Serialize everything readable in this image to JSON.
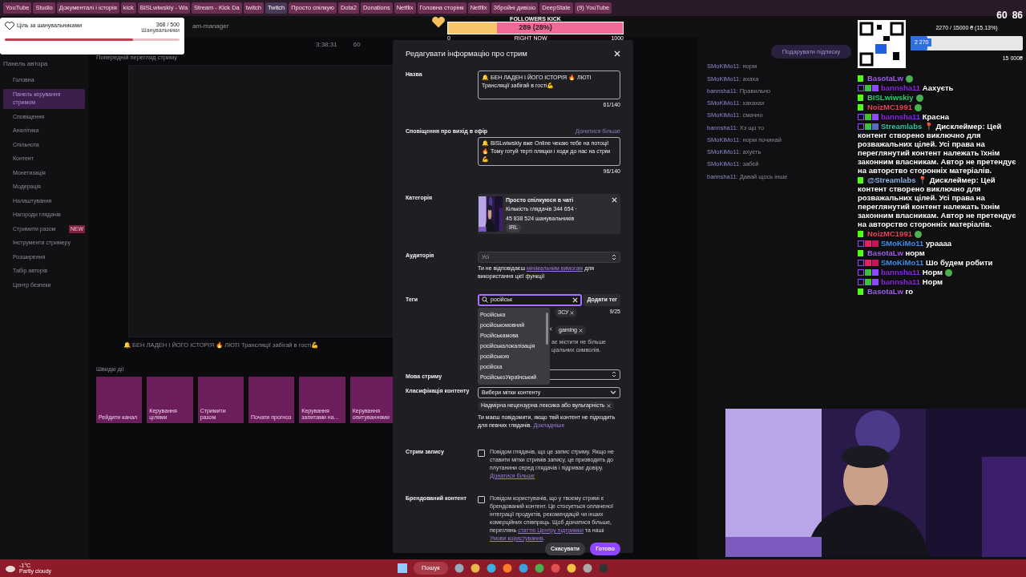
{
  "browser_tabs": [
    {
      "label": "YouTube",
      "selected": false
    },
    {
      "label": "Studio",
      "selected": false
    },
    {
      "label": "Документалі і історія",
      "selected": false
    },
    {
      "label": "kick",
      "selected": false
    },
    {
      "label": "BISLwiwskiy - Wa",
      "selected": false
    },
    {
      "label": "Stream - Kick Da",
      "selected": false
    },
    {
      "label": "twitch",
      "selected": false
    },
    {
      "label": "Twitch",
      "selected": true
    },
    {
      "label": "Просто спілкую",
      "selected": false
    },
    {
      "label": "Dota2",
      "selected": false
    },
    {
      "label": "Donations",
      "selected": false
    },
    {
      "label": "Netflix",
      "selected": false
    },
    {
      "label": "Головна сторінк",
      "selected": false
    },
    {
      "label": "Netflix",
      "selected": false
    },
    {
      "label": "Збройні дивізіо",
      "selected": false
    },
    {
      "label": "DeepState",
      "selected": false
    },
    {
      "label": "(9) YouTube",
      "selected": false
    }
  ],
  "address": "am-manager",
  "goal_widget": {
    "title": "Ціль за шанувальниками",
    "count": "368 / 500",
    "unit": "Шанувальники",
    "level": 0.736
  },
  "followers_bar": {
    "title": "FOLLOWERS KICK",
    "reading": "289 (28%)",
    "level": 0.28,
    "min": "0",
    "mid": "RIGHT NOW",
    "max": "1000"
  },
  "counters": [
    "60",
    "86"
  ],
  "donation_goal": {
    "reading": "2270 / 15000 ₴ (15.13%)",
    "badge": "2 270",
    "max": "15 000₴",
    "level": 0.1513
  },
  "sidebar": {
    "title": "Панель автора",
    "items": [
      {
        "label": "Головна",
        "selected": false
      },
      {
        "label": "Панель керування стримом",
        "selected": true
      },
      {
        "label": "Сповіщення",
        "selected": false
      },
      {
        "label": "Аналітика",
        "selected": false
      },
      {
        "label": "Спільнота",
        "selected": false
      },
      {
        "label": "Контент",
        "selected": false
      },
      {
        "label": "Монетизація",
        "selected": false
      },
      {
        "label": "Модерація",
        "selected": false
      },
      {
        "label": "Налаштування",
        "selected": false
      },
      {
        "label": "Нагороди глядачів",
        "selected": false
      },
      {
        "label": "Стримити разом",
        "selected": false,
        "badge": "NEW"
      },
      {
        "label": "Інструменти стримеру",
        "selected": false
      },
      {
        "label": "Розширення",
        "selected": false
      },
      {
        "label": "Табір авторів",
        "selected": false
      },
      {
        "label": "Центр безпеки",
        "selected": false
      }
    ]
  },
  "stats": [
    "3:38:31",
    "60"
  ],
  "preview": {
    "title": "Попередній перегляд стриму",
    "stream_title": "🔔 БЕН ЛАДЕН І ЙОГО ІСТОРІЯ 🔥 ЛЮТІ Трансляції забігай в гості💪"
  },
  "quick_actions": {
    "title": "Швидкі дії",
    "tiles": [
      {
        "label": "Рейдити канал",
        "color": "#6b1d5c"
      },
      {
        "label": "Керування цілями",
        "color": "#6b1d5c"
      },
      {
        "label": "Стримити разом",
        "color": "#6b1d5c"
      },
      {
        "label": "Почати прогноз",
        "color": "#6b1d5c"
      },
      {
        "label": "Керування запитами на...",
        "color": "#6b1d5c"
      },
      {
        "label": "Керування опитуваннями",
        "color": "#6b1d5c"
      }
    ]
  },
  "modal": {
    "title": "Редагувати інформацію про стрим",
    "name": {
      "label": "Назва",
      "value": "🔔 БЕН ЛАДЕН І ЙОГО ІСТОРІЯ 🔥 ЛЮТІ Трансляції забігай в гості💪",
      "count": "61/140"
    },
    "notification": {
      "label": "Сповіщення про вихід в ефір",
      "link": "Дізнатися більше",
      "value": "🔔 BISLwiwskiy вже Online чекаю тебе на потоці! 🔥 Тому готуй терті пляцки і ходи до нас на стрім 💪",
      "count": "96/140"
    },
    "category": {
      "label": "Категорія",
      "name": "Просто спілкуюся в чаті",
      "viewers": "Кількість глядачів 344 654 ·",
      "followers": "45 838 524 шанувальників",
      "tag": "IRL"
    },
    "audience": {
      "label": "Аудиторія",
      "value": "Усі",
      "note_before": "Ти не відповідаєш",
      "note_link": "мінімальним вимогам",
      "note_after": "для використання цієї функції"
    },
    "tags": {
      "label": "Теги",
      "query": "російськ",
      "add_button": "Додати тег",
      "count": "9/25",
      "visible_tags": [
        "ЗСУ",
        "gaming"
      ],
      "hint_fragments": [
        "ає містити не більше",
        "ціальних символів."
      ],
      "suggestions": [
        "Російська",
        "російськомовний",
        "Російськамова",
        "російськалокалізація",
        "російською",
        "російска",
        "РосійськоУкраїнський"
      ]
    },
    "language": {
      "label": "Мова стриму"
    },
    "classification": {
      "label": "Класифікація контенту",
      "placeholder": "Вибери мітки контенту",
      "chip": "Надмірна нецензурна лексика або вульгарність",
      "note": "Ти маєш повідомити, якщо твій контент не підходить для певних глядачів.",
      "note_link": "Докладніше"
    },
    "rerun": {
      "label": "Стрим запису",
      "checked": false,
      "text": "Повідом глядачів, що це запис стриму. Якщо не ставити мітки стримів запису, це призводить до плутанини серед глядачів і підриває довіру.",
      "link": "Дізнатися більше"
    },
    "branded": {
      "label": "Брендований контент",
      "checked": false,
      "text": "Повідом користувачів, що у твоєму стримі є брендований контент. Це стосується оплаченої інтеграції продуктів, рекомендацій чи інших комерційних співпраць. Щоб дізнатися більше, переглянь",
      "link1": "статтю Центру підтримки",
      "middle": "та наші",
      "link2": "Умови користування",
      "end": "."
    },
    "cancel": "Скасувати",
    "done": "Готово"
  },
  "bg_chat": {
    "gift_button": "Подарувати підписку",
    "lines": [
      {
        "user": "SMoKiMo11",
        "text": ": норм"
      },
      {
        "user": "SMoKiMo11",
        "text": ": ахаха"
      },
      {
        "user": "bannsha11",
        "text": ": Правильно"
      },
      {
        "user": "SMoKiMo11",
        "text": ": хахахах"
      },
      {
        "user": "SMoKiMo11",
        "text": ": смачно"
      },
      {
        "user": "bannsha11",
        "text": ": Хз що то"
      },
      {
        "user": "SMoKiMo11",
        "text": ": норм починай"
      },
      {
        "user": "SMoKiMo11",
        "text": ": ахуєть"
      },
      {
        "user": "SMoKiMo11",
        "text": ": забєй"
      },
      {
        "user": "bannsha11",
        "text": ": Давай щось інше"
      }
    ]
  },
  "chat": [
    {
      "kind": "kick",
      "user": "BasotaLw",
      "color": "#a45ef0",
      "emote": true
    },
    {
      "kind": "twitch",
      "badges": [
        {
          "color": "#3fbf3f"
        },
        {
          "color": "#9146ff"
        }
      ],
      "user": "bannsha11",
      "color": "#8a2be2",
      "text": "Аахуєть",
      "emote": false
    },
    {
      "kind": "kick",
      "user": "BISLwiwskiy",
      "color": "#2ecc71",
      "emote": true
    },
    {
      "kind": "kick",
      "user": "NoizMC1991",
      "color": "#e8475b",
      "emote": true
    },
    {
      "kind": "twitch",
      "badges": [
        {
          "color": "#3fbf3f"
        },
        {
          "color": "#9146ff"
        }
      ],
      "user": "bannsha11",
      "color": "#8a2be2",
      "text": "Красна",
      "emote": false
    },
    {
      "kind": "twitch",
      "badges": [
        {
          "color": "#3fbf3f"
        },
        {
          "color": "#5c6bc0"
        }
      ],
      "user": "Streamlabs",
      "color": "#31c3a2",
      "text": "📍 Дисклеймер: Цей контент створено виключно для розважальних цілей. Усі права на переглянутий контент належать їхнім законним власникам. Автор не претендує на авторство сторонніх матеріалів.",
      "emote": false
    },
    {
      "kind": "kick",
      "user": "@Streamlabs",
      "color": "#8fb4e8",
      "text": "📍 Дисклеймер: Цей контент створено виключно для розважальних цілей. Усі права на переглянутий контент належать їхнім законним власникам. Автор не претендує на авторство сторонніх матеріалів.",
      "emote": false
    },
    {
      "kind": "kick",
      "user": "NoizMC1991",
      "color": "#e8475b",
      "emote": true
    },
    {
      "kind": "twitch",
      "badges": [
        {
          "color": "#e91e63"
        },
        {
          "color": "#c2185b"
        }
      ],
      "user": "SMoKiMo11",
      "color": "#3d8ff5",
      "text": "ураааа",
      "emote": false
    },
    {
      "kind": "kick",
      "user": "BasotaLw",
      "color": "#a45ef0",
      "text": "норм",
      "emote": false
    },
    {
      "kind": "twitch",
      "badges": [
        {
          "color": "#e91e63"
        },
        {
          "color": "#c2185b"
        }
      ],
      "user": "SMoKiMo11",
      "color": "#3d8ff5",
      "text": "Шо будем робити",
      "emote": false
    },
    {
      "kind": "twitch",
      "badges": [
        {
          "color": "#3fbf3f"
        },
        {
          "color": "#9146ff"
        }
      ],
      "user": "bannsha11",
      "color": "#8a2be2",
      "text": "Норм",
      "emote": true
    },
    {
      "kind": "twitch",
      "badges": [
        {
          "color": "#3fbf3f"
        },
        {
          "color": "#9146ff"
        }
      ],
      "user": "bannsha11",
      "color": "#8a2be2",
      "text": "Норм",
      "emote": false
    },
    {
      "kind": "kick",
      "user": "BasotaLw",
      "color": "#a45ef0",
      "text": "го",
      "emote": false
    }
  ],
  "taskbar": {
    "temperature": "-1°C",
    "weather": "Partly cloudy",
    "search": "Пошук"
  }
}
